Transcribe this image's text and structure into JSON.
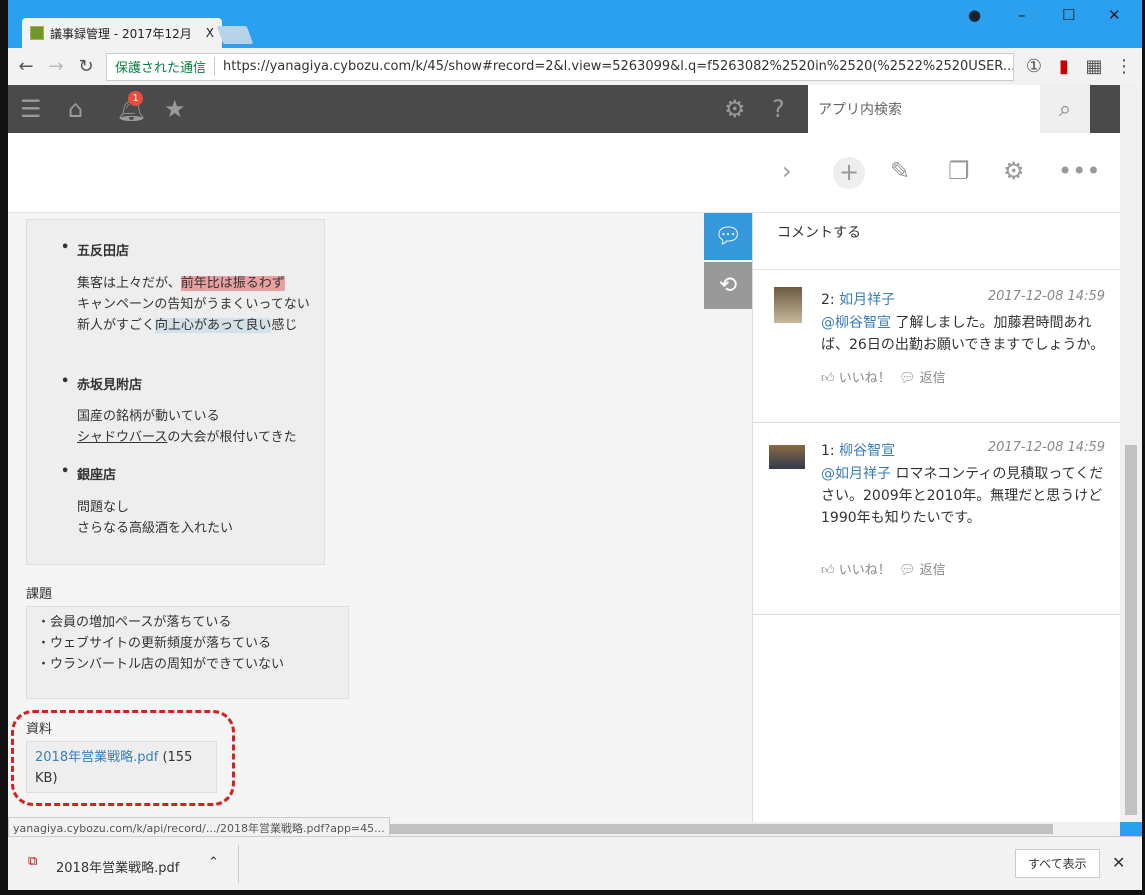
{
  "browser": {
    "tab_title": "議事録管理 - 2017年12月",
    "tab_close": "X",
    "secure_label": "保護された通信",
    "url": "https://yanagiya.cybozu.com/k/45/show#record=2&l.view=5263099&l.q=f5263082%2520in%2520(%2522%2520USER...",
    "status_url": "yanagiya.cybozu.com/k/api/record/.../2018年営業戦略.pdf?app=45..."
  },
  "app": {
    "notification_count": "1",
    "search_placeholder": "アプリ内検索"
  },
  "record": {
    "stores": [
      {
        "name": "五反田店",
        "lines": [
          [
            "集客は上々だが、",
            "前年比は振るわず"
          ],
          [
            "キャンペーンの告知がうまくいってない"
          ],
          [
            "新人がすごく",
            "向上心があって良い",
            "感じ"
          ]
        ]
      },
      {
        "name": "赤坂見附店",
        "lines": [
          [
            "国産の銘柄が動いている"
          ],
          [
            "シャドウバース",
            "の大会が根付いてきた"
          ]
        ]
      },
      {
        "name": "銀座店",
        "lines": [
          [
            "問題なし"
          ],
          [
            "さらなる高級酒を入れたい"
          ]
        ]
      }
    ],
    "issues_label": "課題",
    "issues": [
      "・会員の増加ペースが落ちている",
      "・ウェブサイトの更新頻度が落ちている",
      "・ウランバートル店の周知ができていない"
    ],
    "materials_label": "資料",
    "file_name": "2018年営業戦略.pdf",
    "file_size": "(155 KB)"
  },
  "comments": {
    "placeholder": "コメントする",
    "items": [
      {
        "num": "2:",
        "author": "如月祥子",
        "time": "2017-12-08 14:59",
        "mention": "@柳谷智宣",
        "text": " 了解しました。加藤君時間あれば、26日の出勤お願いできますでしょうか。",
        "like": "いいね！",
        "reply": "返信"
      },
      {
        "num": "1:",
        "author": "柳谷智宣",
        "time": "2017-12-08 14:59",
        "mention": "@如月祥子",
        "text": " ロマネコンティの見積取ってください。2009年と2010年。無理だと思うけど1990年も知りたいです。",
        "like": "いいね！",
        "reply": "返信"
      }
    ]
  },
  "downloads": {
    "file": "2018年営業戦略.pdf",
    "show_all": "すべて表示"
  }
}
